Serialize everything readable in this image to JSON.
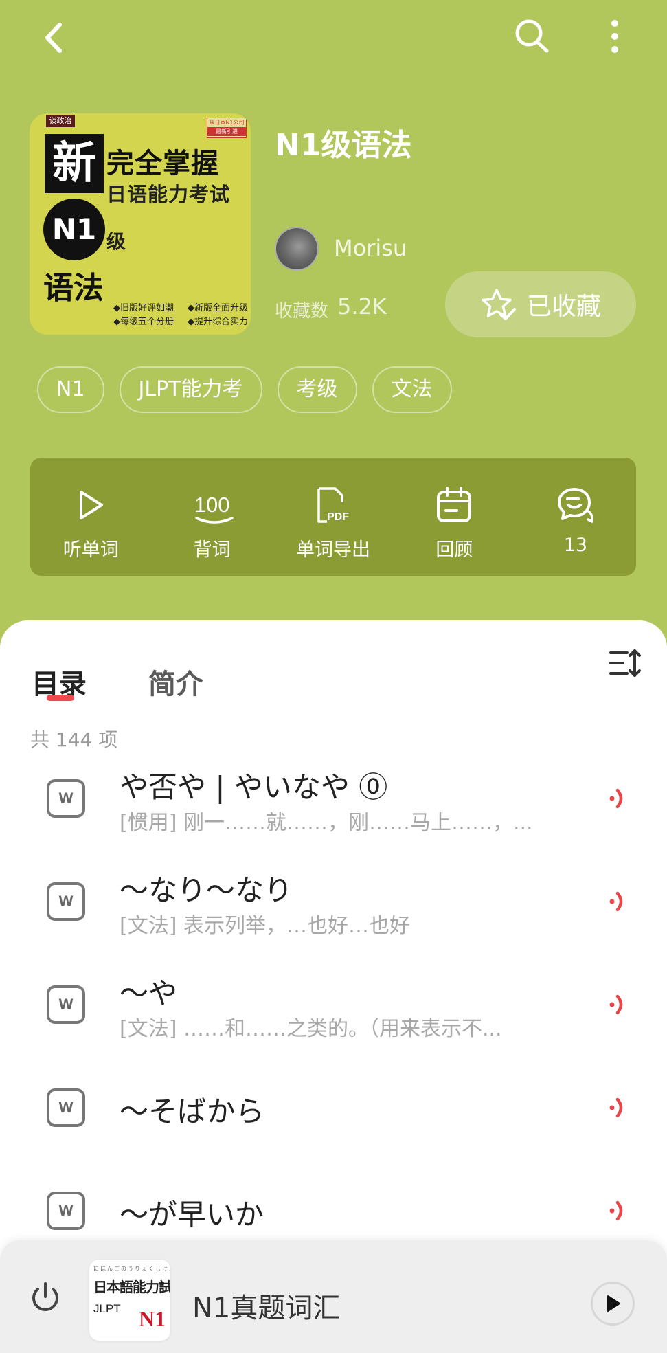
{
  "colors": {
    "hero_bg": "#b1c65b",
    "action_bar_bg": "#8a9c33",
    "accent_red": "#f2484f",
    "speaker_red": "#e8474c"
  },
  "icons": {
    "back": "chevron-left-icon",
    "search": "search-icon",
    "more": "more-vertical-icon",
    "favorite": "star-check-icon",
    "sort": "sort-order-icon",
    "list_item": "w-box-icon",
    "speaker": "speaker-icon",
    "power": "power-icon",
    "play": "play-icon"
  },
  "book": {
    "title": "N1级语法",
    "author": "Morisu",
    "favorites_label": "收藏数",
    "favorites_count": "5.2K",
    "favorite_button_label": "已收藏",
    "cover": {
      "series": "谈政治",
      "xin": "新",
      "line1": "完全掌握",
      "line2": "日语能力考试",
      "level": "N1",
      "ji": "级",
      "subject": "语法",
      "badge_top": "从日本N1公司",
      "badge_bottom": "最新引进",
      "bullet1": "◆旧版好评如潮",
      "bullet2": "◆新版全面升级",
      "bullet3": "◆每级五个分册",
      "bullet4": "◆提升综合实力"
    }
  },
  "tags": [
    "N1",
    "JLPT能力考",
    "考级",
    "文法"
  ],
  "actions": [
    {
      "label": "听单词",
      "icon": "play-outline-icon"
    },
    {
      "label": "背词",
      "icon": "hundred-icon",
      "icon_text": "100"
    },
    {
      "label": "单词导出",
      "icon": "pdf-file-icon",
      "icon_text": "PDF"
    },
    {
      "label": "回顾",
      "icon": "calendar-icon"
    },
    {
      "label": "13",
      "icon": "comment-icon"
    }
  ],
  "tabs": {
    "toc": "目录",
    "intro": "简介"
  },
  "list": {
    "count_label": "共 144 项",
    "items": [
      {
        "word": "や否や | やいなや ⓪",
        "definition": "[惯用] 刚一……就……，刚……马上……，..."
      },
      {
        "word": "～なり～なり",
        "definition": "[文法] 表示列举，…也好…也好"
      },
      {
        "word": "～や",
        "definition": "[文法] ……和……之类的。（用来表示不..."
      },
      {
        "word": "～そばから",
        "definition": ""
      },
      {
        "word": "～が早いか",
        "definition": ""
      }
    ]
  },
  "player": {
    "title": "N1真题词汇",
    "thumb_kana": "にほんごのうりょくしけん",
    "thumb_title": "日本語能力試験",
    "thumb_sub": "JLPT",
    "thumb_level": "N1"
  }
}
